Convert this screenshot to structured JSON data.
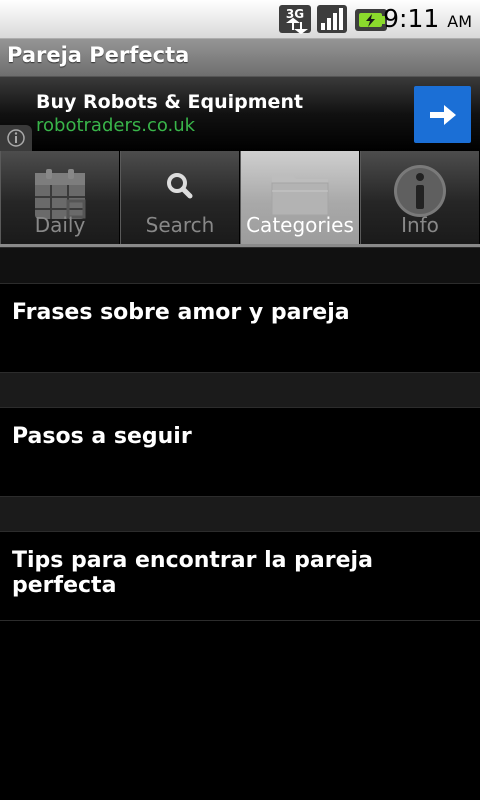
{
  "status_bar": {
    "time": "9:11",
    "ampm": "AM",
    "network": "3G",
    "icons": [
      "3g-data-icon",
      "signal-icon",
      "battery-charging-icon"
    ]
  },
  "title_bar": {
    "title": "Pareja Perfecta"
  },
  "ad": {
    "title": "Buy Robots & Equipment",
    "url": "robotraders.co.uk",
    "url_color": "#39b54a",
    "button_color": "#1b6fd6",
    "icons": [
      "arrow-right-icon",
      "info-icon"
    ]
  },
  "tabs": [
    {
      "label": "Daily",
      "icon": "calendar-icon",
      "selected": false
    },
    {
      "label": "Search",
      "icon": "search-icon",
      "selected": false
    },
    {
      "label": "Categories",
      "icon": "folder-icon",
      "selected": true
    },
    {
      "label": "Info",
      "icon": "info-icon",
      "selected": false
    }
  ],
  "list": {
    "items": [
      {
        "label": "Frases sobre amor y pareja"
      },
      {
        "label": "Pasos a seguir"
      },
      {
        "label": "Tips para encontrar la pareja perfecta"
      }
    ]
  }
}
